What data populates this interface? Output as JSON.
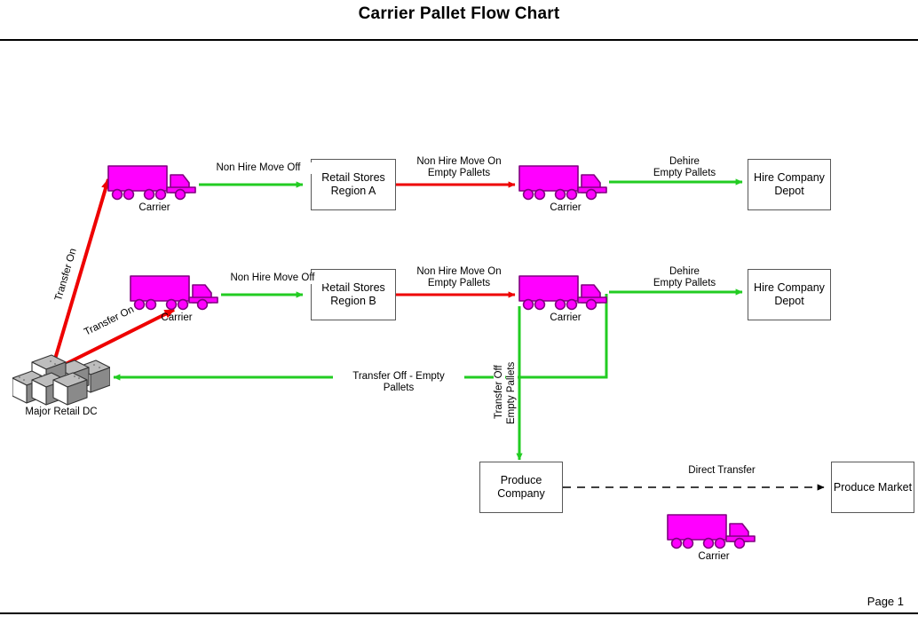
{
  "document": {
    "title": "Carrier Pallet Flow Chart",
    "page_number": "Page 1"
  },
  "nodes": {
    "retail_stores_a": "Retail Stores\nRegion A",
    "retail_stores_b": "Retail Stores\nRegion B",
    "hire_depot_a": "Hire Company\nDepot",
    "hire_depot_b": "Hire Company\nDepot",
    "produce_company": "Produce Company",
    "produce_market": "Produce Market",
    "major_retail_dc": "Major Retail DC"
  },
  "carriers": {
    "carrier_r1_left": "Carrier",
    "carrier_r1_right": "Carrier",
    "carrier_r2_left": "Carrier",
    "carrier_r2_right": "Carrier",
    "carrier_bottom": "Carrier"
  },
  "edges": {
    "transfer_on_top": "Transfer On",
    "transfer_on_bottom": "Transfer On",
    "non_hire_move_off_a": "Non Hire Move Off",
    "non_hire_move_off_b": "Non Hire Move Off",
    "non_hire_move_on_a": "Non Hire Move On\nEmpty Pallets",
    "non_hire_move_on_b": "Non Hire Move On\nEmpty Pallets",
    "dehire_a": "Dehire\nEmpty Pallets",
    "dehire_b": "Dehire\nEmpty Pallets",
    "transfer_off_empty_pallets": "Transfer Off - Empty Pallets",
    "transfer_off_vert_line1": "Transfer Off",
    "transfer_off_vert_line2": "Empty Pallets",
    "direct_transfer": "Direct Transfer"
  },
  "colors": {
    "flow_green": "#22CC22",
    "flow_red": "#EE0000",
    "flow_dashed": "#000000",
    "truck_body": "#FF00FF",
    "truck_outline": "#800080",
    "box_border": "#585858",
    "cube_face_top": "#BDBDBD",
    "cube_face_side": "#8A8A8A",
    "cube_face_front": "#FFFFFF",
    "cube_outline": "#333333",
    "page_background": "#FFFFFF",
    "text": "#000000"
  },
  "icons": {
    "truck": "truck-icon",
    "warehouse": "warehouse-cubes-icon"
  }
}
